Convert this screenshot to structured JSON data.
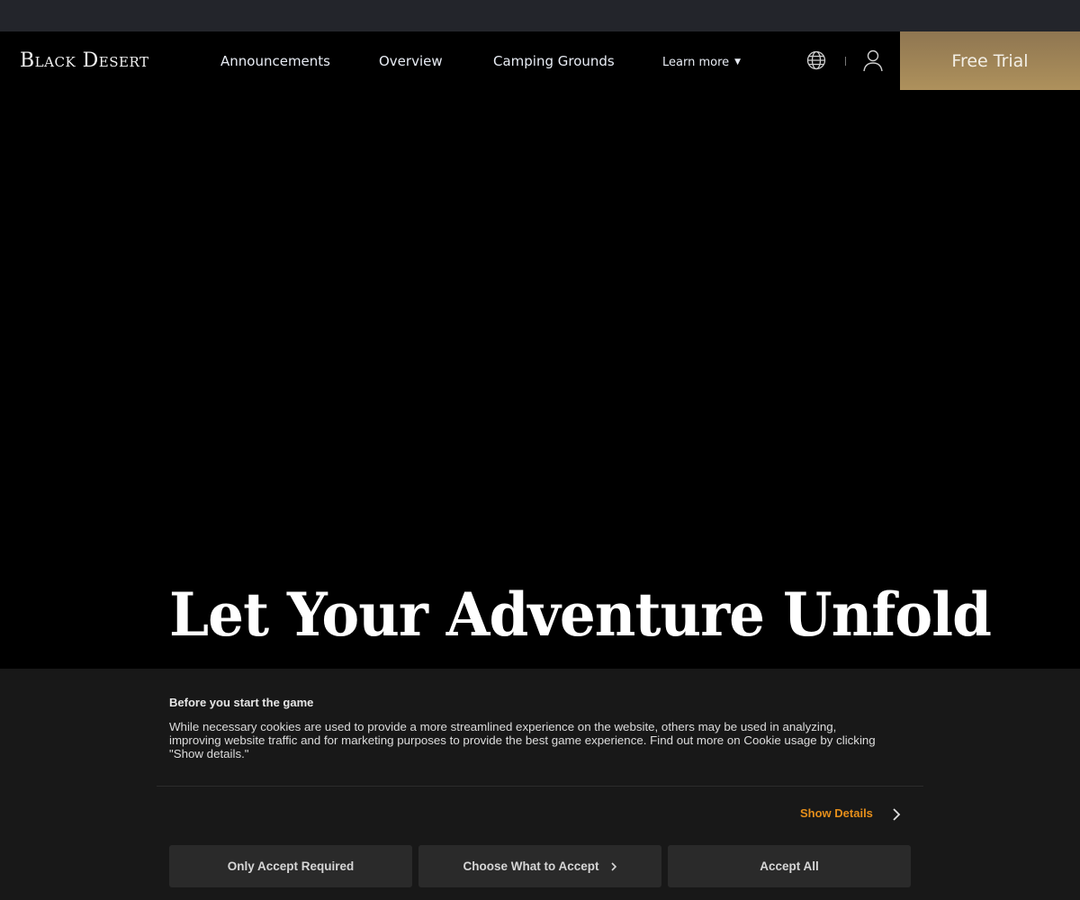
{
  "header": {
    "logo_text": "Black Desert",
    "nav": [
      {
        "label": "Announcements"
      },
      {
        "label": "Overview"
      },
      {
        "label": "Camping Grounds"
      },
      {
        "label": "Learn more"
      }
    ],
    "icons": {
      "language": "globe-icon",
      "account": "user-icon",
      "learn_more_caret": "▼"
    },
    "cta_label": "Free Trial",
    "cta_color": "#a48a5a"
  },
  "hero": {
    "title": "Let Your Adventure Unfold"
  },
  "cookie_banner": {
    "title": "Before you start the game",
    "body": "While necessary cookies are used to provide a more streamlined experience on the website, others may be used in analyzing, improving website traffic and for marketing purposes to provide the best game experience. Find out more on Cookie usage by clicking \"Show details.\"",
    "show_details_label": "Show Details",
    "show_details_color": "#e58e1a",
    "buttons": [
      {
        "label": "Only Accept Required"
      },
      {
        "label": "Choose What to Accept"
      },
      {
        "label": "Accept All"
      }
    ]
  }
}
